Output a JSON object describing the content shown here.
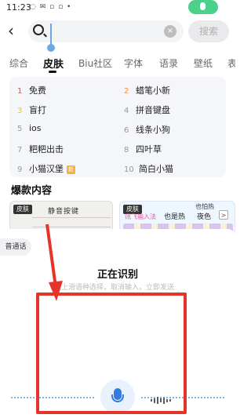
{
  "status_bar": {
    "time": "11:23",
    "icons": "◌ ✉ ▫ ▫ •"
  },
  "search": {
    "placeholder": "",
    "value": "",
    "button_label": "搜索",
    "clear_glyph": "×"
  },
  "tabs": [
    {
      "label": "综合"
    },
    {
      "label": "皮肤",
      "active": true
    },
    {
      "label": "Biu社区"
    },
    {
      "label": "字体"
    },
    {
      "label": "语录"
    },
    {
      "label": "壁纸"
    },
    {
      "label": "表"
    }
  ],
  "hot_list": [
    {
      "rank": "1",
      "label": "免费"
    },
    {
      "rank": "2",
      "label": "蜡笔小新"
    },
    {
      "rank": "3",
      "label": "盲打"
    },
    {
      "rank": "4",
      "label": "拼音键盘"
    },
    {
      "rank": "5",
      "label": "ios"
    },
    {
      "rank": "6",
      "label": "线条小狗"
    },
    {
      "rank": "7",
      "label": "粑粑出击"
    },
    {
      "rank": "8",
      "label": "四叶草"
    },
    {
      "rank": "9",
      "label": "小猫汉堡",
      "badge": "新"
    },
    {
      "rank": "10",
      "label": "简白小猫"
    }
  ],
  "section_title": "爆款内容",
  "cards": [
    {
      "tag": "皮肤",
      "title": "静音按键"
    },
    {
      "tag": "皮肤",
      "also_text": "也怕热",
      "text_a": "讯飞输入法",
      "text_b": "也是热",
      "text_c": "夜色",
      "arrow": ">"
    }
  ],
  "voice": {
    "mode_label": "普通话",
    "status_title": "正在识别",
    "hint": "上滑语种选择，取消输入，立即发送"
  },
  "colors": {
    "accent_blue": "#2f7de1",
    "annotation_red": "#e5352b",
    "mic_pill_green": "#4cd18a"
  }
}
